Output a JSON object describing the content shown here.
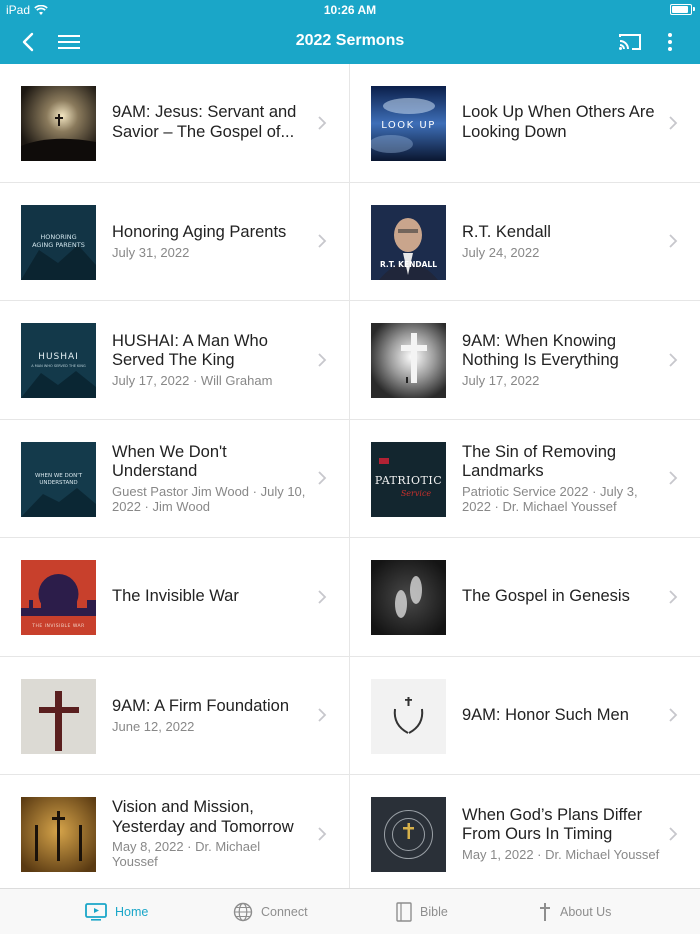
{
  "status": {
    "device": "iPad",
    "time": "10:26 AM"
  },
  "nav": {
    "title": "2022 Sermons"
  },
  "sermons": [
    {
      "title": "9AM: Jesus: Servant and Savior – The Gospel of...",
      "subtitle": "",
      "thumb_text": ""
    },
    {
      "title": "Look Up When Others Are Looking Down",
      "subtitle": "",
      "thumb_text": "LOOK UP"
    },
    {
      "title": "Honoring Aging Parents",
      "subtitle": "July 31, 2022",
      "thumb_text": "HONORING AGING PARENTS"
    },
    {
      "title": "R.T. Kendall",
      "subtitle": "July 24, 2022",
      "thumb_text": "R.T. KENDALL"
    },
    {
      "title": "HUSHAI: A Man Who Served The King",
      "subtitle": "July 17, 2022 · Will Graham",
      "thumb_text": "HUSHAI"
    },
    {
      "title": "9AM: When Knowing Nothing Is Everything",
      "subtitle": "July 17, 2022",
      "thumb_text": ""
    },
    {
      "title": "When We Don't Understand",
      "subtitle": "Guest Pastor Jim Wood · July 10, 2022 · Jim Wood",
      "thumb_text": "WHEN WE DON'T UNDERSTAND"
    },
    {
      "title": "The Sin of Removing Landmarks",
      "subtitle": "Patriotic Service 2022 · July 3, 2022 · Dr. Michael Youssef",
      "thumb_text": "PATRIOTIC"
    },
    {
      "title": "The Invisible War",
      "subtitle": "",
      "thumb_text": "THE INVISIBLE WAR"
    },
    {
      "title": "The Gospel in Genesis",
      "subtitle": "",
      "thumb_text": ""
    },
    {
      "title": "9AM: A Firm Foundation",
      "subtitle": "June 12, 2022",
      "thumb_text": ""
    },
    {
      "title": "9AM: Honor Such Men",
      "subtitle": "",
      "thumb_text": ""
    },
    {
      "title": "Vision and Mission, Yesterday and Tomorrow",
      "subtitle": "May 8, 2022 · Dr. Michael Youssef",
      "thumb_text": ""
    },
    {
      "title": "When God’s Plans Differ From Ours In Timing",
      "subtitle": "May 1, 2022 · Dr. Michael Youssef",
      "thumb_text": ""
    }
  ],
  "tabs": [
    {
      "label": "Home",
      "icon": "tv-icon",
      "active": true
    },
    {
      "label": "Connect",
      "icon": "globe-icon",
      "active": false
    },
    {
      "label": "Bible",
      "icon": "book-icon",
      "active": false
    },
    {
      "label": "About Us",
      "icon": "cross-icon",
      "active": false
    }
  ],
  "colors": {
    "accent": "#1aa6c8",
    "tab_inactive": "#8e8e8e"
  }
}
